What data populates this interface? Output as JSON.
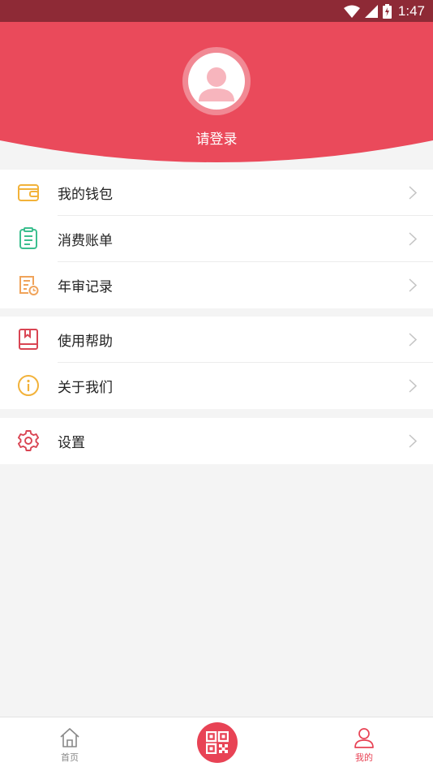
{
  "status_bar": {
    "time": "1:47"
  },
  "profile": {
    "login_text": "请登录"
  },
  "menu_groups": [
    {
      "items": [
        {
          "label": "我的钱包",
          "icon": "wallet-icon"
        },
        {
          "label": "消费账单",
          "icon": "bill-icon"
        },
        {
          "label": "年审记录",
          "icon": "record-icon"
        }
      ]
    },
    {
      "items": [
        {
          "label": "使用帮助",
          "icon": "help-book-icon"
        },
        {
          "label": "关于我们",
          "icon": "info-icon"
        }
      ]
    },
    {
      "items": [
        {
          "label": "设置",
          "icon": "gear-icon"
        }
      ]
    }
  ],
  "tabbar": {
    "home_label": "首页",
    "mine_label": "我的",
    "active_color": "#e84355",
    "inactive_color": "#888888"
  },
  "colors": {
    "brand": "#e84355",
    "header": "#ea4a5b",
    "status_bar": "#8e2a36"
  }
}
